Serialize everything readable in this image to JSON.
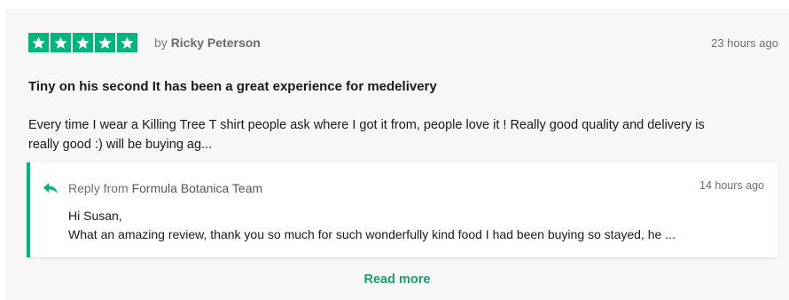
{
  "review": {
    "rating": 5,
    "rating_max": 5,
    "star_color": "#00b67a",
    "by_prefix": "by",
    "author": "Ricky Peterson",
    "time": "23 hours ago",
    "title": "Tiny on his second It has been a great experience for medelivery",
    "body_line1": "Every time I wear a Killing Tree T shirt people ask where I got it from, people love it ! Really good quality and delivery is",
    "body_line2": "really good :) will be buying ag..."
  },
  "reply": {
    "prefix": "Reply from",
    "company": "Formula Botanica Team",
    "time": "14 hours ago",
    "greeting": "Hi Susan,",
    "text": "What an amazing review, thank you so much for such wonderfully kind food I had been buying so stayed, he ...",
    "accent_color": "#00b67a"
  },
  "read_more_label": "Read more"
}
